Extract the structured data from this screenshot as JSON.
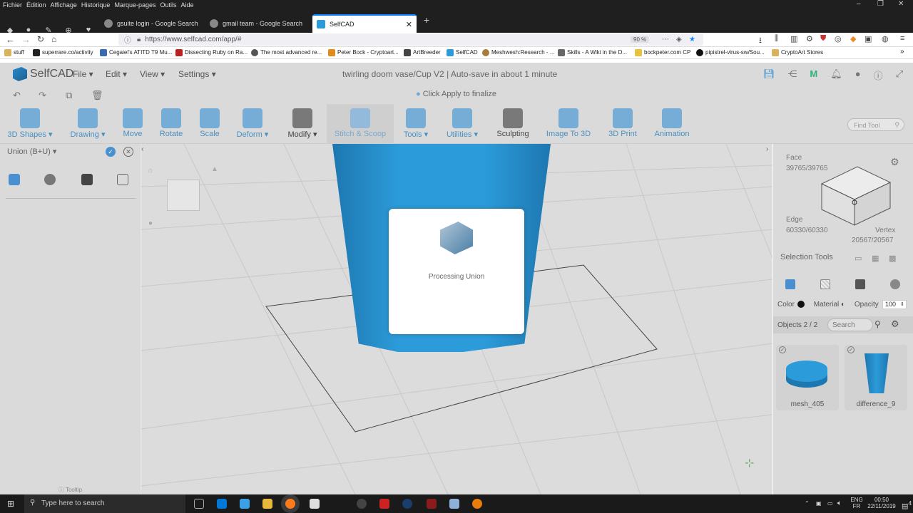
{
  "browser": {
    "menu": [
      "Fichier",
      "Édition",
      "Affichage",
      "Historique",
      "Marque-pages",
      "Outils",
      "Aide"
    ],
    "tabs": [
      {
        "label": "gsuite login - Google Search"
      },
      {
        "label": "gmail team - Google Search"
      },
      {
        "label": "SelfCAD"
      }
    ],
    "new_tab": "+",
    "url": "https://www.selfcad.com/app/#",
    "zoom": "90 %",
    "bookmarks": [
      "stuff",
      "superrare.co/activity",
      "Cegaiel's ATITD T9 Mu...",
      "Dissecting Ruby on Ra...",
      "The most advanced re...",
      "Peter Bock - Cryptoart...",
      "ArtBreeder",
      "SelfCAD",
      "Meshwesh:Research - ...",
      "Skills - A Wiki in the D...",
      "bockpeter.com CP",
      "pipistrel-virus-sw/Sou...",
      "CryptoArt Stores"
    ]
  },
  "app": {
    "logo": "SelfCAD",
    "menus": [
      "File",
      "Edit",
      "View",
      "Settings"
    ],
    "doc_title": "twirling doom vase/Cup V2",
    "autosave": "Auto-save in about 1 minute",
    "hint": "Click Apply to finalize",
    "find_tool_placeholder": "Find Tool",
    "toolbar": [
      {
        "label": "3D Shapes",
        "dd": true
      },
      {
        "label": "Drawing",
        "dd": true
      },
      {
        "label": "Move",
        "dd": false
      },
      {
        "label": "Rotate",
        "dd": false
      },
      {
        "label": "Scale",
        "dd": false
      },
      {
        "label": "Deform",
        "dd": true
      },
      {
        "label": "Modify",
        "dd": true
      },
      {
        "label": "Stitch & Scoop",
        "dd": false
      },
      {
        "label": "Tools",
        "dd": true
      },
      {
        "label": "Utilities",
        "dd": true
      },
      {
        "label": "Sculpting",
        "dd": false
      },
      {
        "label": "Image To 3D",
        "dd": false
      },
      {
        "label": "3D Print",
        "dd": false
      },
      {
        "label": "Animation",
        "dd": false
      }
    ]
  },
  "left_panel": {
    "title": "Union (B+U)",
    "tooltip": "Tooltip"
  },
  "modal": {
    "text": "Processing Union"
  },
  "right_panel": {
    "face_label": "Face",
    "face_count": "39765/39765",
    "edge_label": "Edge",
    "edge_count": "60330/60330",
    "vertex_label": "Vertex",
    "vertex_count": "20567/20567",
    "selection_tools": "Selection Tools",
    "color_label": "Color",
    "material_label": "Material",
    "opacity_label": "Opacity",
    "opacity_value": "100",
    "objects_label": "Objects 2 / 2",
    "search_placeholder": "Search",
    "objects": [
      {
        "name": "mesh_405"
      },
      {
        "name": "difference_9"
      }
    ]
  },
  "taskbar": {
    "search_placeholder": "Type here to search",
    "lang1": "ENG",
    "lang2": "FR",
    "time": "00:50",
    "date": "22/11/2019",
    "notif": "4"
  },
  "colors": {
    "accent": "#2c9bd9",
    "toolbar_bg": "#dadada",
    "viewport_bg": "#dcdcdc"
  }
}
